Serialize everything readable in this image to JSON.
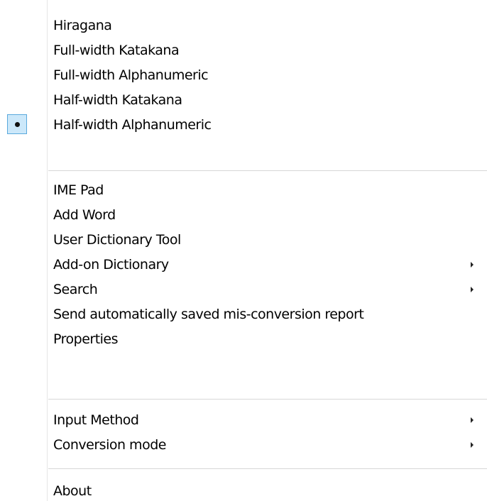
{
  "menu": {
    "section1": [
      {
        "label": "Hiragana"
      },
      {
        "label": "Full-width Katakana"
      },
      {
        "label": "Full-width Alphanumeric"
      },
      {
        "label": "Half-width Katakana"
      },
      {
        "label": "Half-width Alphanumeric",
        "selected": true
      }
    ],
    "section2": [
      {
        "label": "IME Pad"
      },
      {
        "label": "Add Word"
      },
      {
        "label": "User Dictionary Tool"
      },
      {
        "label": "Add-on Dictionary",
        "submenu": true
      },
      {
        "label": "Search",
        "submenu": true
      },
      {
        "label": "Send automatically saved mis-conversion report"
      },
      {
        "label": "Properties"
      }
    ],
    "section3": [
      {
        "label": "Input Method",
        "submenu": true
      },
      {
        "label": "Conversion mode",
        "submenu": true
      }
    ],
    "section4": [
      {
        "label": "About"
      }
    ]
  },
  "colors": {
    "selection_fill": "#cce8fa",
    "selection_border": "#5aa9dd",
    "separator": "#d7d7d7"
  }
}
